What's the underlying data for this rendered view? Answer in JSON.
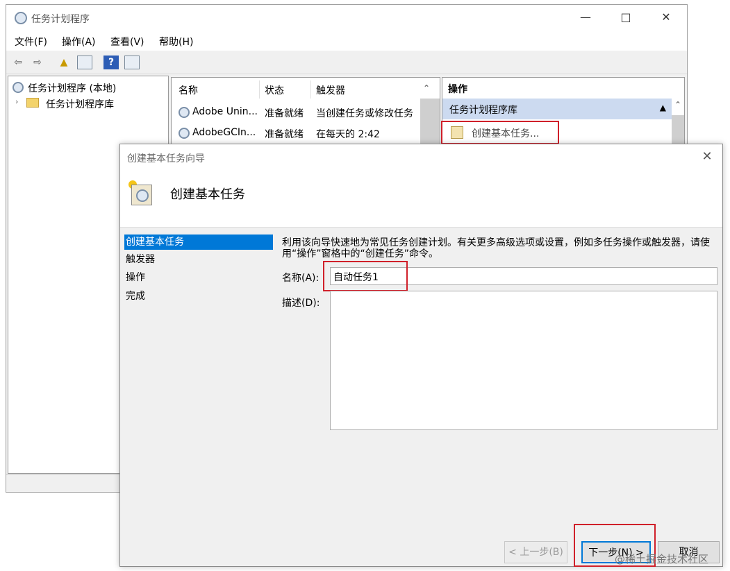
{
  "main_window": {
    "title": "任务计划程序",
    "menu": [
      "文件(F)",
      "操作(A)",
      "查看(V)",
      "帮助(H)"
    ],
    "tree": {
      "root": "任务计划程序 (本地)",
      "library": "任务计划程序库"
    },
    "task_list": {
      "columns": [
        "名称",
        "状态",
        "触发器"
      ],
      "rows": [
        {
          "name": "Adobe Unin...",
          "status": "准备就绪",
          "trigger": "当创建任务或修改任务"
        },
        {
          "name": "AdobeGCIn...",
          "status": "准备就绪",
          "trigger": "在每天的 2:42"
        }
      ]
    },
    "actions": {
      "header": "操作",
      "section": "任务计划程序库",
      "create_basic_task": "创建基本任务..."
    }
  },
  "dialog": {
    "title": "创建基本任务向导",
    "heading": "创建基本任务",
    "steps": [
      "创建基本任务",
      "触发器",
      "操作",
      "完成"
    ],
    "description": "利用该向导快速地为常见任务创建计划。有关更多高级选项或设置，例如多任务操作或触发器，请使用“操作”窗格中的“创建任务”命令。",
    "name_label": "名称(A):",
    "name_value": "自动任务1",
    "desc_label": "描述(D):",
    "back_button": "< 上一步(B)",
    "next_button": "下一步(N) >",
    "cancel_button": "取消"
  },
  "watermark": "@稀土掘金技术社区",
  "colors": {
    "highlight_box": "#d0202a",
    "selected_step": "#0078d7",
    "actions_section": "#ccdaf0"
  }
}
